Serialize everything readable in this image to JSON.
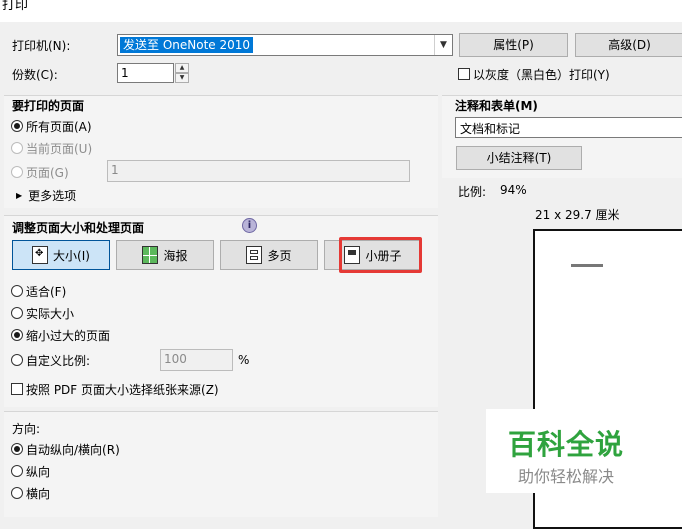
{
  "window": {
    "title": "打印"
  },
  "printer": {
    "label": "打印机(N):",
    "selected": "发送至 OneNote 2010",
    "properties_btn": "属性(P)",
    "advanced_btn": "高级(D)"
  },
  "copies": {
    "label": "份数(C):",
    "value": "1"
  },
  "grayscale": {
    "label": "以灰度（黑白色）打印(Y)",
    "checked": false
  },
  "pages": {
    "title": "要打印的页面",
    "all": "所有页面(A)",
    "current": "当前页面(U)",
    "pages_label": "页面(G)",
    "pages_value": "1",
    "more": "更多选项"
  },
  "sizing": {
    "title": "调整页面大小和处理页面",
    "buttons": {
      "size": "大小(I)",
      "poster": "海报",
      "multiple": "多页",
      "booklet": "小册子"
    },
    "fit": "适合(F)",
    "actual": "实际大小",
    "shrink": "缩小过大的页面",
    "custom": "自定义比例:",
    "custom_value": "100",
    "percent": "%",
    "paper_source": "按照 PDF 页面大小选择纸张来源(Z)"
  },
  "orientation": {
    "title": "方向:",
    "auto": "自动纵向/横向(R)",
    "portrait": "纵向",
    "landscape": "横向"
  },
  "comments": {
    "title": "注释和表单(M)",
    "value": "文档和标记",
    "summarize_btn": "小结注释(T)"
  },
  "preview": {
    "scale_label": "比例:",
    "scale_value": "94%",
    "paper_size": "21 x 29.7 厘米"
  },
  "watermark": {
    "main": "百科全说",
    "sub": "助你轻松解决"
  },
  "colors": {
    "accent": "#0078d7",
    "highlight": "#e53935",
    "watermark_green": "#2fa33e"
  }
}
